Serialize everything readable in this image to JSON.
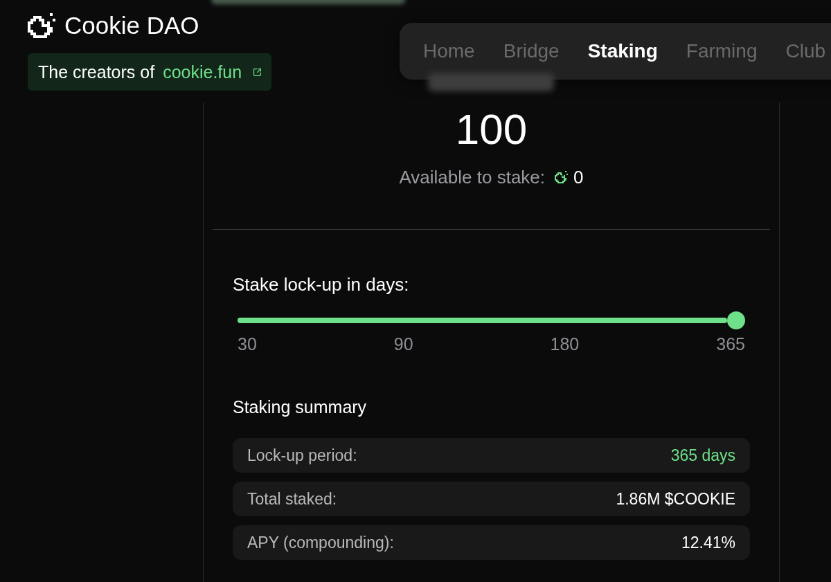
{
  "brand": {
    "name": "Cookie DAO",
    "tagline": "The creators of",
    "link": "cookie.fun"
  },
  "nav": [
    {
      "label": "Home",
      "selected": false
    },
    {
      "label": "Bridge",
      "selected": false
    },
    {
      "label": "Staking",
      "selected": true
    },
    {
      "label": "Farming",
      "selected": false
    },
    {
      "label": "Club",
      "selected": false
    }
  ],
  "stake_card": {
    "amount": "100",
    "available": {
      "label": "Available to stake:",
      "value": "0"
    },
    "lockup": {
      "label": "Stake lock-up in days:",
      "level": 1,
      "ticks": [
        "30",
        "90",
        "180",
        "365"
      ]
    },
    "summary": {
      "title": "Staking summary",
      "rows": [
        {
          "label": "Lock-up period:",
          "value": "365 days",
          "highlighted": true
        },
        {
          "label": "Total staked:",
          "value": "1.86M $COOKIE",
          "highlighted": false
        },
        {
          "label": "APY (compounding):",
          "value": "12.41%",
          "highlighted": false
        }
      ]
    }
  }
}
